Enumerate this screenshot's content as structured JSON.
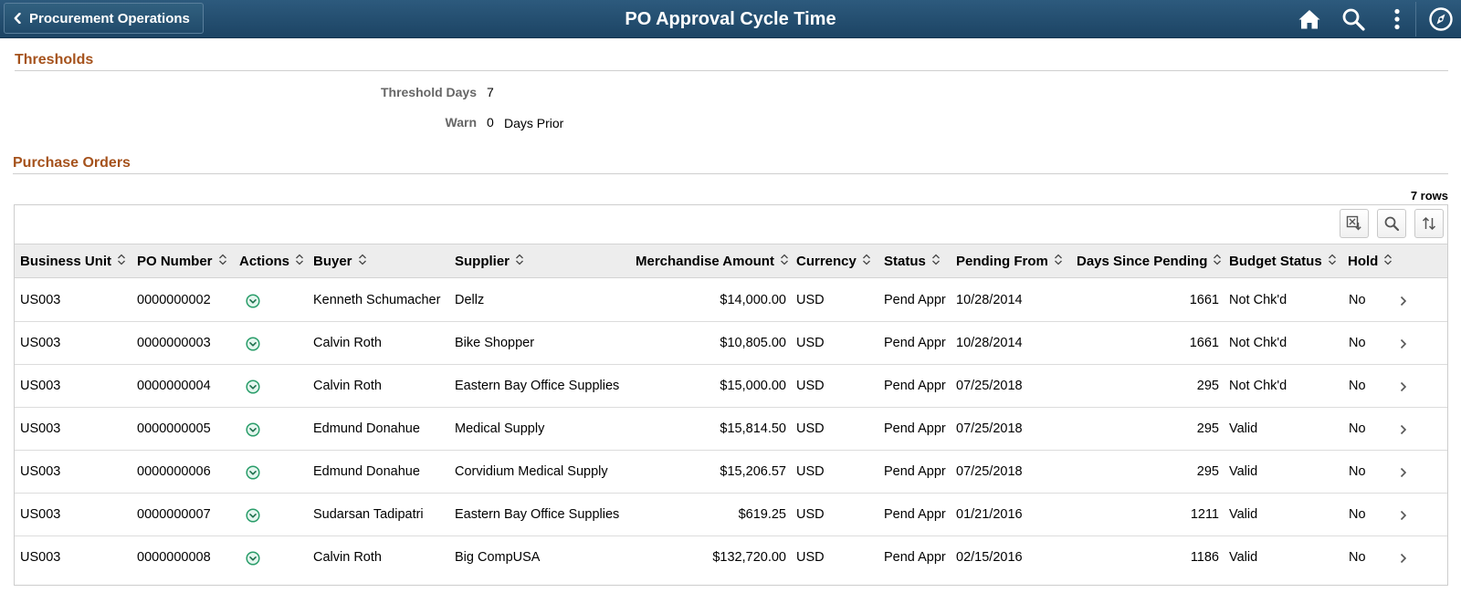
{
  "header": {
    "back_label": "Procurement Operations",
    "title": "PO Approval Cycle Time",
    "icons": [
      "home-icon",
      "search-icon",
      "more-options-icon",
      "navbar-compass-icon"
    ]
  },
  "thresholds": {
    "section_title": "Thresholds",
    "threshold_days_label": "Threshold Days",
    "threshold_days_value": "7",
    "warn_label": "Warn",
    "warn_value": "0",
    "warn_suffix": "Days Prior"
  },
  "purchase_orders": {
    "section_title": "Purchase Orders",
    "row_count": "7 rows",
    "toolbar_icons": [
      "export-excel-icon",
      "find-icon",
      "sort-icon"
    ],
    "columns": [
      "Business Unit",
      "PO Number",
      "Actions",
      "Buyer",
      "Supplier",
      "Merchandise Amount",
      "Currency",
      "Status",
      "Pending From",
      "Days Since Pending",
      "Budget Status",
      "Hold"
    ],
    "rows": [
      {
        "business_unit": "US003",
        "po_number": "0000000002",
        "buyer": "Kenneth Schumacher",
        "supplier": "Dellz",
        "amount": "$14,000.00",
        "currency": "USD",
        "status": "Pend Appr",
        "pending_from": "10/28/2014",
        "days": "1661",
        "budget_status": "Not Chk'd",
        "hold": "No"
      },
      {
        "business_unit": "US003",
        "po_number": "0000000003",
        "buyer": "Calvin Roth",
        "supplier": "Bike Shopper",
        "amount": "$10,805.00",
        "currency": "USD",
        "status": "Pend Appr",
        "pending_from": "10/28/2014",
        "days": "1661",
        "budget_status": "Not Chk'd",
        "hold": "No"
      },
      {
        "business_unit": "US003",
        "po_number": "0000000004",
        "buyer": "Calvin Roth",
        "supplier": "Eastern Bay Office Supplies",
        "amount": "$15,000.00",
        "currency": "USD",
        "status": "Pend Appr",
        "pending_from": "07/25/2018",
        "days": "295",
        "budget_status": "Not Chk'd",
        "hold": "No"
      },
      {
        "business_unit": "US003",
        "po_number": "0000000005",
        "buyer": "Edmund Donahue",
        "supplier": "Medical Supply",
        "amount": "$15,814.50",
        "currency": "USD",
        "status": "Pend Appr",
        "pending_from": "07/25/2018",
        "days": "295",
        "budget_status": "Valid",
        "hold": "No"
      },
      {
        "business_unit": "US003",
        "po_number": "0000000006",
        "buyer": "Edmund Donahue",
        "supplier": "Corvidium Medical Supply",
        "amount": "$15,206.57",
        "currency": "USD",
        "status": "Pend Appr",
        "pending_from": "07/25/2018",
        "days": "295",
        "budget_status": "Valid",
        "hold": "No"
      },
      {
        "business_unit": "US003",
        "po_number": "0000000007",
        "buyer": "Sudarsan Tadipatri",
        "supplier": "Eastern Bay Office Supplies",
        "amount": "$619.25",
        "currency": "USD",
        "status": "Pend Appr",
        "pending_from": "01/21/2016",
        "days": "1211",
        "budget_status": "Valid",
        "hold": "No"
      },
      {
        "business_unit": "US003",
        "po_number": "0000000008",
        "buyer": "Calvin Roth",
        "supplier": "Big CompUSA",
        "amount": "$132,720.00",
        "currency": "USD",
        "status": "Pend Appr",
        "pending_from": "02/15/2016",
        "days": "1186",
        "budget_status": "Valid",
        "hold": "No"
      }
    ]
  },
  "colors": {
    "header_bg": "#1c4464",
    "section_title": "#a5521c",
    "action_icon": "#2a9d6a"
  }
}
